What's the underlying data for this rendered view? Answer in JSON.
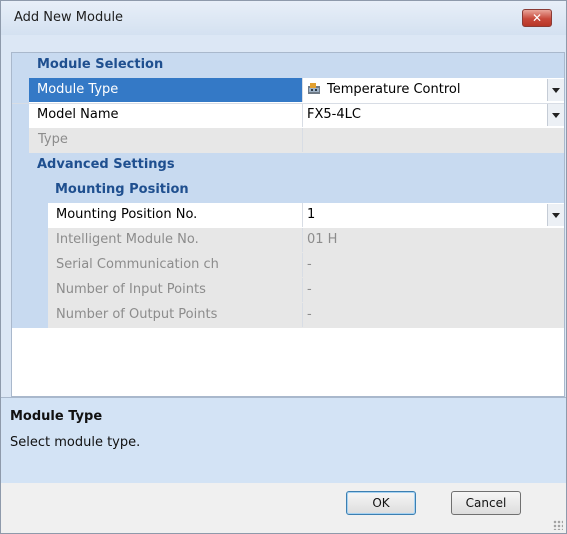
{
  "window": {
    "title": "Add New Module",
    "close_glyph": "✕"
  },
  "sections": {
    "module_selection": "Module Selection",
    "advanced_settings": "Advanced Settings",
    "mounting_position": "Mounting Position"
  },
  "rows": {
    "module_type": {
      "label": "Module Type",
      "value": "Temperature Control",
      "icon": "module-icon"
    },
    "model_name": {
      "label": "Model Name",
      "value": "FX5-4LC"
    },
    "type": {
      "label": "Type",
      "value": ""
    },
    "mounting_position_no": {
      "label": "Mounting Position No.",
      "value": "1"
    },
    "intelligent_module_no": {
      "label": "Intelligent Module No.",
      "value": "01 H"
    },
    "serial_comm_ch": {
      "label": "Serial Communication ch",
      "value": "-"
    },
    "input_points": {
      "label": "Number of Input Points",
      "value": "-"
    },
    "output_points": {
      "label": "Number of Output Points",
      "value": "-"
    }
  },
  "description": {
    "title": "Module Type",
    "text": "Select module type."
  },
  "buttons": {
    "ok": "OK",
    "cancel": "Cancel"
  },
  "colors": {
    "selected": "#3479c6",
    "section": "#c8daf0",
    "section_text": "#1f4f8f"
  }
}
